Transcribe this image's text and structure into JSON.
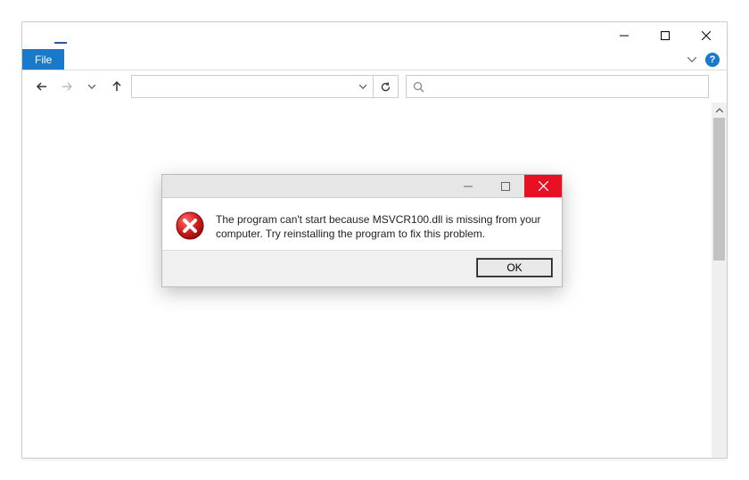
{
  "window": {
    "file_label": "File"
  },
  "address": {
    "value": ""
  },
  "search": {
    "placeholder": "",
    "value": ""
  },
  "dialog": {
    "message": "The program can't start because MSVCR100.dll is missing from your computer. Try reinstalling the program to fix this problem.",
    "ok_label": "OK"
  },
  "icons": {
    "help": "?"
  }
}
